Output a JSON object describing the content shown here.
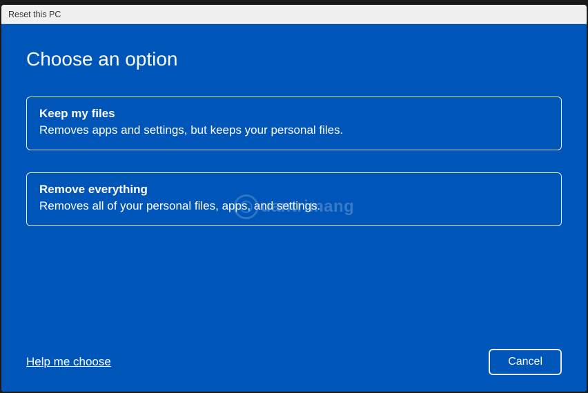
{
  "window": {
    "title": "Reset this PC"
  },
  "page": {
    "heading": "Choose an option"
  },
  "options": {
    "keep": {
      "title": "Keep my files",
      "description": "Removes apps and settings, but keeps your personal files."
    },
    "remove": {
      "title": "Remove everything",
      "description": "Removes all of your personal files, apps, and settings."
    }
  },
  "footer": {
    "help_link": "Help me choose",
    "cancel_label": "Cancel"
  },
  "watermark": {
    "text": "uantrimang"
  },
  "colors": {
    "background": "#0055b8",
    "text": "#ffffff",
    "titlebar_bg": "#f0f0f0"
  }
}
